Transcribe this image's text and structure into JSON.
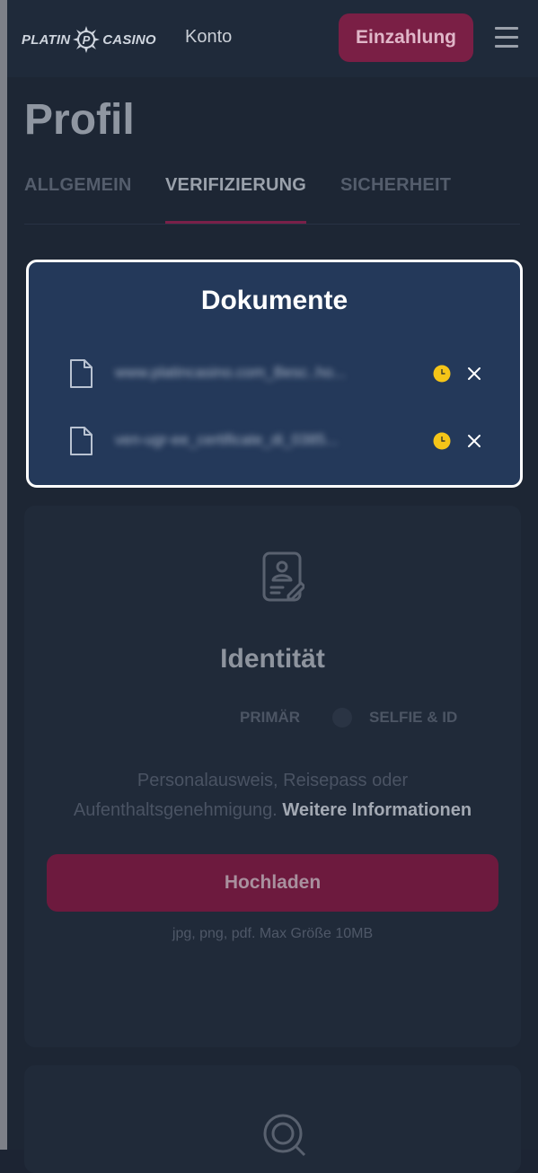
{
  "header": {
    "logo_left": "PLATIN",
    "logo_mark": "P",
    "logo_right": "CASINO",
    "nav_label": "Konto",
    "deposit_label": "Einzahlung",
    "menu_icon": "hamburger-icon"
  },
  "page": {
    "title": "Profil",
    "tabs": [
      {
        "label": "ALLGEMEIN",
        "active": false
      },
      {
        "label": "VERIFIZIERUNG",
        "active": true
      },
      {
        "label": "SICHERHEIT",
        "active": false
      }
    ]
  },
  "documents": {
    "title": "Dokumente",
    "items": [
      {
        "name": "www.platincasino.com_Besc..ho...",
        "status_icon": "clock-icon",
        "status_color": "#f5c518",
        "remove_icon": "close-icon"
      },
      {
        "name": "ven-ugr-ee_certificate_di_0385...",
        "status_icon": "clock-icon",
        "status_color": "#f5c518",
        "remove_icon": "close-icon"
      }
    ]
  },
  "identity": {
    "title": "Identität",
    "step_primary": "PRIMÄR",
    "step_selfie": "SELFIE & ID",
    "description": "Personalausweis, Reisepass oder Aufenthaltsgenehmigung.",
    "more_link": "Weitere Informationen",
    "upload_label": "Hochladen",
    "file_hint": "jpg, png, pdf. Max Größe 10MB"
  },
  "colors": {
    "accent": "#c2185b",
    "modal_border": "#ffffff",
    "pending": "#f5c518"
  }
}
